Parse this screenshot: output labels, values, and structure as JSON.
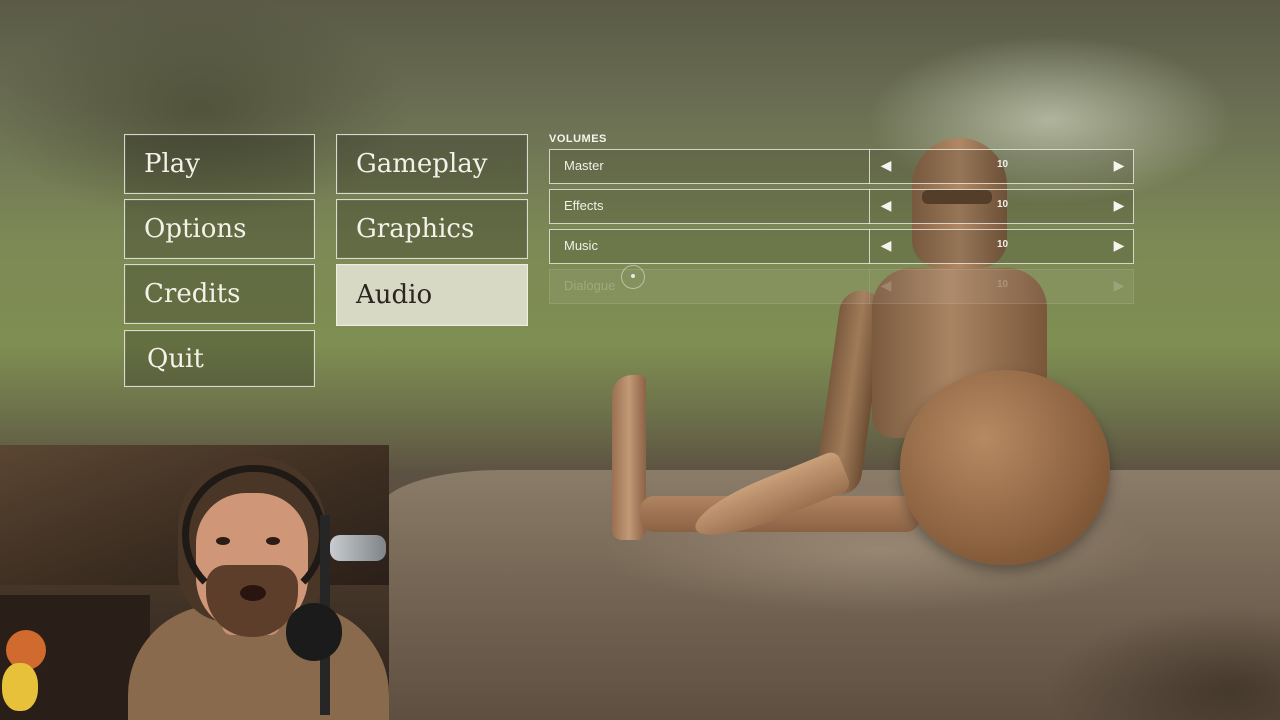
{
  "main_menu": {
    "items": [
      "Play",
      "Options",
      "Credits",
      "Quit"
    ]
  },
  "options_menu": {
    "items": [
      "Gameplay",
      "Graphics",
      "Audio"
    ],
    "selected": "Audio"
  },
  "volumes": {
    "heading": "VOLUMES",
    "rows": [
      {
        "label": "Master",
        "value": "10",
        "disabled": false
      },
      {
        "label": "Effects",
        "value": "10",
        "disabled": false
      },
      {
        "label": "Music",
        "value": "10",
        "disabled": false
      },
      {
        "label": "Dialogue",
        "value": "10",
        "disabled": true
      }
    ]
  },
  "icons": {
    "left": "arrow-left-icon",
    "right": "arrow-right-icon",
    "cursor": "pointer-cursor-icon"
  },
  "colors": {
    "panel_border": "#f0eee6",
    "selected_bg": "#e8e6d8",
    "selected_text": "#2a2720"
  }
}
